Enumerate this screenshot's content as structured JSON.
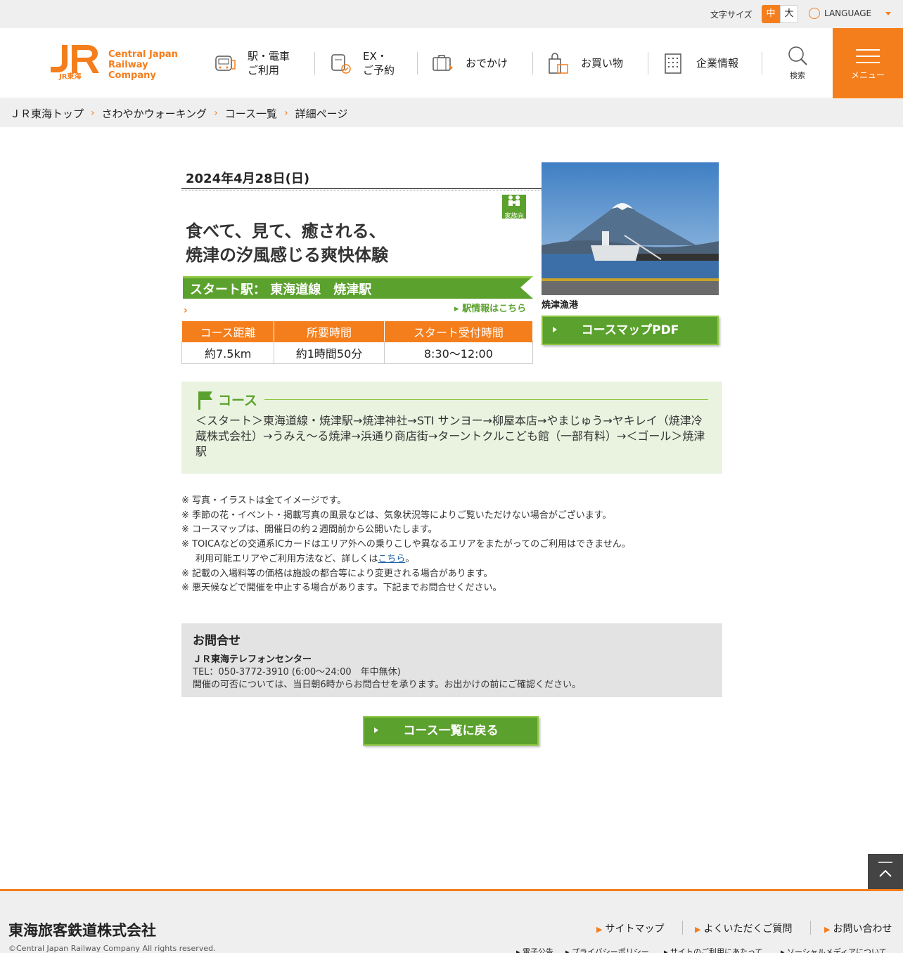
{
  "topbar": {
    "font_size_label": "文字サイズ",
    "font_mid": "中",
    "font_big": "大",
    "language": "LANGUAGE"
  },
  "logo": {
    "sub": "JR東海",
    "en_line1": "Central Japan",
    "en_line2": "Railway Company"
  },
  "nav": [
    {
      "label1": "駅・電車",
      "label2": "ご利用",
      "icon": "train-icon"
    },
    {
      "label1": "EX・",
      "label2": "ご予約",
      "icon": "ticket-icon"
    },
    {
      "label1": "おでかけ",
      "label2": "",
      "icon": "suitcase-icon"
    },
    {
      "label1": "お買い物",
      "label2": "",
      "icon": "shopping-bag-icon"
    },
    {
      "label1": "企業情報",
      "label2": "",
      "icon": "building-icon"
    }
  ],
  "search_label": "検索",
  "menu_label": "メニュー",
  "breadcrumb": [
    "ＪＲ東海トップ",
    "さわやかウォーキング",
    "コース一覧",
    "詳細ページ"
  ],
  "event": {
    "date": "2024年4月28日(日)",
    "family_badge": "家族向",
    "title_line1": "食べて、見て、癒される、",
    "title_line2": "焼津の汐風感じる爽快体験",
    "start_station": "スタート駅：  東海道線　焼津駅",
    "station_link": "駅情報はこちら",
    "table_headers": [
      "コース距離",
      "所要時間",
      "スタート受付時間"
    ],
    "table_values": [
      "約7.5km",
      "約1時間50分",
      "8:30〜12:00"
    ],
    "photo_caption": "焼津漁港",
    "pdf_button": "コースマップPDF"
  },
  "course": {
    "heading": "コース",
    "body": "＜スタート＞東海道線・焼津駅→焼津神社→STI サンヨー→柳屋本店→やまじゅう→ヤキレイ（焼津冷蔵株式会社）→うみえ〜る焼津→浜通り商店街→ターントクルこども館（一部有料）→＜ゴール＞焼津駅"
  },
  "notes": {
    "n1": "※ 写真・イラストは全てイメージです。",
    "n2": "※ 季節の花・イベント・掲載写真の風景などは、気象状況等によりご覧いただけない場合がございます。",
    "n3": "※ コースマップは、開催日の約２週間前から公開いたします。",
    "n4": "※ TOICAなどの交通系ICカードはエリア外への乗りこしや異なるエリアをまたがってのご利用はできません。",
    "n4b_pre": "利用可能エリアやご利用方法など、詳しくは",
    "n4b_link": "こちら",
    "n4b_post": "。",
    "n5": "※ 記載の入場料等の価格は施設の都合等により変更される場合があります。",
    "n6": "※ 悪天候などで開催を中止する場合があります。下記までお問合せください。"
  },
  "contact": {
    "heading": "お問合せ",
    "name": "ＪＲ東海テレフォンセンター",
    "tel": "TEL：050-3772-3910 (6:00〜24:00　年中無休)",
    "note": "開催の可否については、当日朝6時からお問合せを承ります。お出かけの前にご確認ください。"
  },
  "back_button": "コース一覧に戻る",
  "footer": {
    "corp": "東海旅客鉄道株式会社",
    "copyright": "©Central Japan Railway Company All rights reserved.",
    "links": [
      "サイトマップ",
      "よくいただくご質問",
      "お問い合わせ"
    ],
    "small_links": [
      "電子公告",
      "プライバシーポリシー",
      "サイトのご利用にあたって",
      "ソーシャルメディアについて"
    ]
  },
  "colors": {
    "accent": "#f57e1c",
    "green": "#5ba12d",
    "light_green": "#eaf3e0"
  }
}
